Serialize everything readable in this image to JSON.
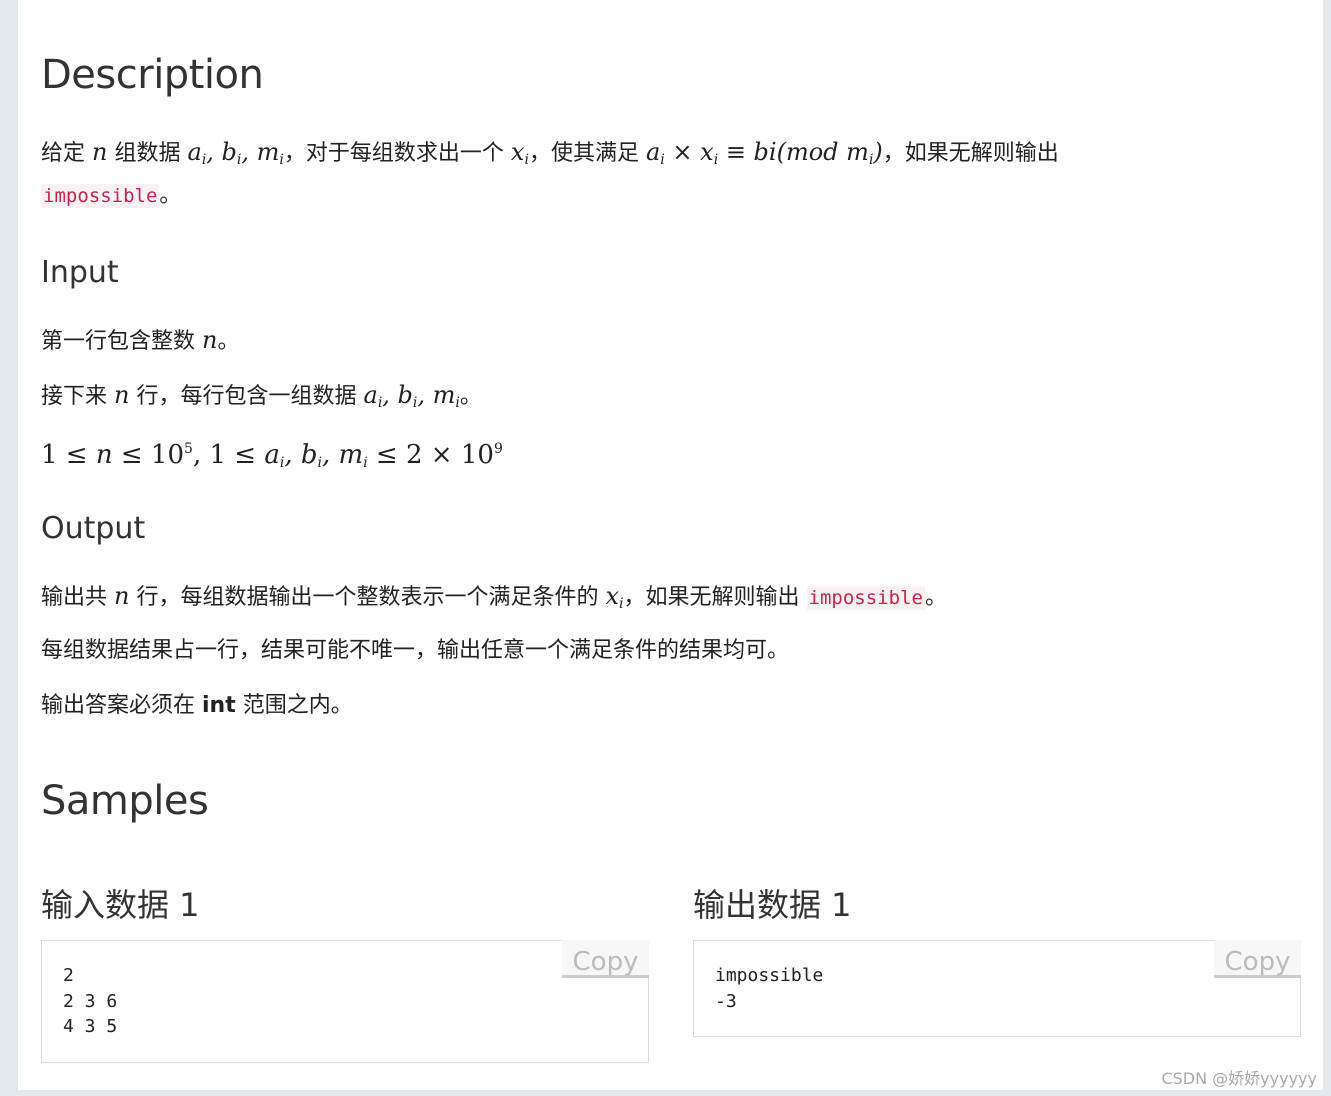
{
  "description": {
    "title": "Description",
    "line1_text1": "给定",
    "n": "n",
    "line1_text2": "组数据",
    "line1_vars": "a",
    "line1_text3": "，对于每组数求出一个",
    "line1_text4": "，使其满足",
    "line1_text5": "，如果无解则输出",
    "code": "impossible",
    "period": "。"
  },
  "input": {
    "title": "Input",
    "line1": "第一行包含整数",
    "line2a": "接下来",
    "line2b": "行，每行包含一组数据",
    "constraint_exp1": "5",
    "constraint_exp2": "9"
  },
  "output": {
    "title": "Output",
    "line1a": "输出共",
    "line1b": "行，每组数据输出一个整数表示一个满足条件的",
    "line1c": "，如果无解则输出",
    "code": "impossible",
    "line2": "每组数据结果占一行，结果可能不唯一，输出任意一个满足条件的结果均可。",
    "line3a": "输出答案必须在",
    "line3b": "int",
    "line3c": "范围之内。"
  },
  "samples": {
    "title": "Samples",
    "input_title": "输入数据 1",
    "input_data": "2\n2 3 6\n4 3 5",
    "output_title": "输出数据 1",
    "output_data": "impossible\n-3",
    "copy_label": "Copy"
  },
  "watermark": "CSDN @娇娇yyyyyy"
}
